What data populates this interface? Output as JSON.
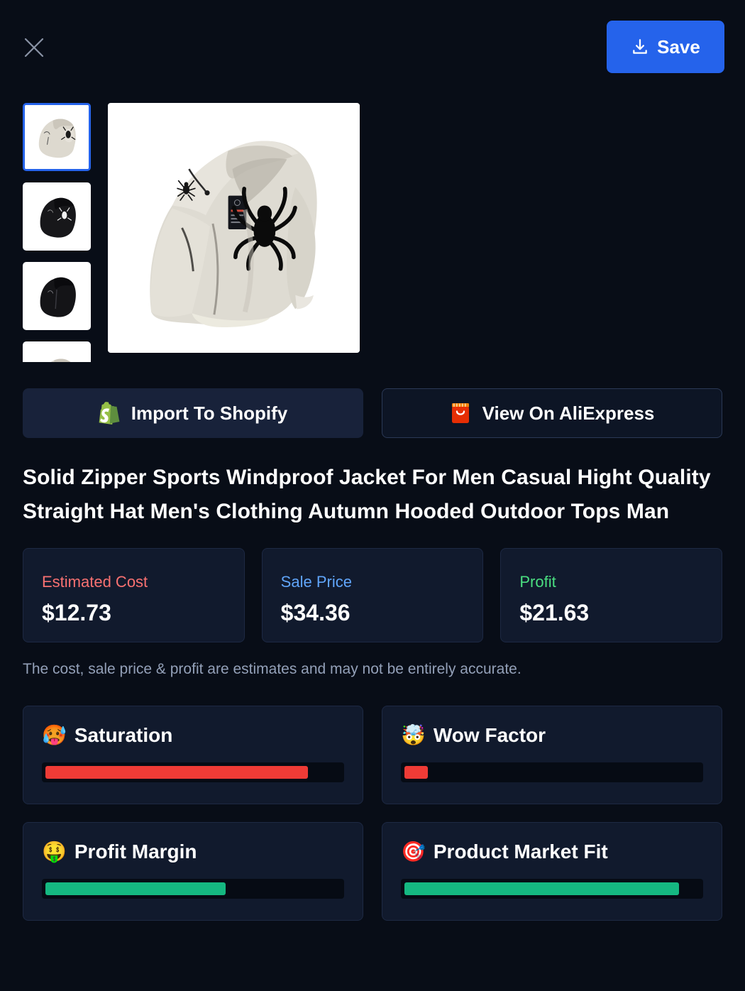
{
  "topbar": {
    "close_label": "close-icon",
    "save_label": "Save"
  },
  "gallery": {
    "selected_index": 0,
    "thumbnails": [
      {
        "alt": "Beige hooded windbreaker jacket with spider print",
        "selected": true
      },
      {
        "alt": "Black hooded windbreaker jacket with white spider print",
        "selected": false
      },
      {
        "alt": "Black hooded windbreaker jacket folded",
        "selected": false
      },
      {
        "alt": "Beige hooded windbreaker jacket partial",
        "selected": false
      }
    ],
    "main_image_alt": "Beige hooded windbreaker jacket with large black spider graphic"
  },
  "actions": [
    {
      "label": "Import To Shopify",
      "icon": "shopify-bag-icon",
      "style": "filled"
    },
    {
      "label": "View On AliExpress",
      "icon": "aliexpress-bag-icon",
      "style": "outlined"
    }
  ],
  "product": {
    "title": "Solid Zipper Sports Windproof Jacket For Men Casual Hight Quality Straight Hat Men's Clothing Autumn Hooded Outdoor Tops Man"
  },
  "pricing": {
    "cards": [
      {
        "label": "Estimated Cost",
        "value": "$12.73",
        "color": "#f87171"
      },
      {
        "label": "Sale Price",
        "value": "$34.36",
        "color": "#60a5fa"
      },
      {
        "label": "Profit",
        "value": "$21.63",
        "color": "#4ade80"
      }
    ],
    "disclaimer": "The cost, sale price & profit are estimates and may not be entirely accurate."
  },
  "metrics": [
    {
      "name": "Saturation",
      "emoji": "🥵",
      "icon": "hot-face-icon",
      "percent": 89,
      "color": "#ef3b36"
    },
    {
      "name": "Wow Factor",
      "emoji": "🤯",
      "icon": "exploding-head-icon",
      "percent": 8,
      "color": "#ef3b36"
    },
    {
      "name": "Profit Margin",
      "emoji": "🤑",
      "icon": "money-mouth-face-icon",
      "percent": 61,
      "color": "#15b881"
    },
    {
      "name": "Product Market Fit",
      "emoji": "🎯",
      "icon": "direct-hit-icon",
      "percent": 93,
      "color": "#15b881"
    }
  ]
}
